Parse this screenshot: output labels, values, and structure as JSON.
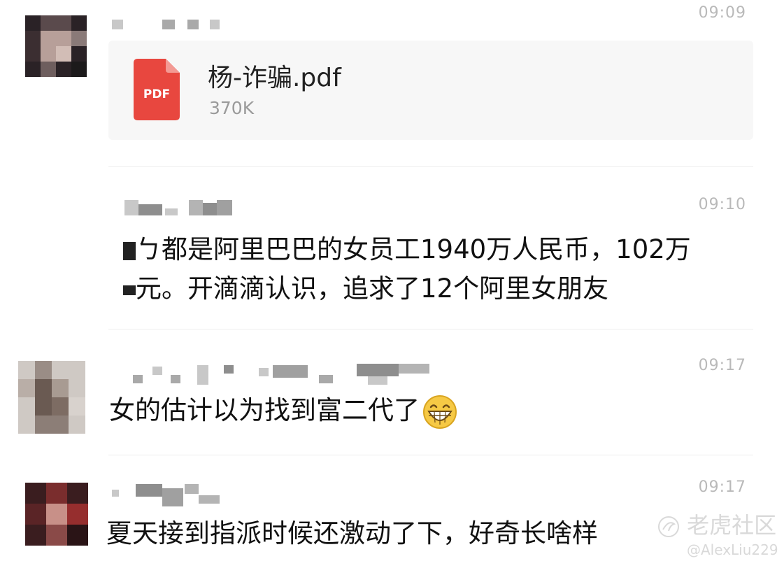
{
  "messages": [
    {
      "time": "09:09",
      "file": {
        "icon": "pdf-icon",
        "icon_label": "PDF",
        "name": "杨-诈骗.pdf",
        "size": "370K",
        "icon_color": "#e8473f"
      }
    },
    {
      "time": "09:10",
      "lines": [
        "ㄅ都是阿里巴巴的女员工1940万人民币，102万",
        "元。开滴滴认识，追求了12个阿里女朋友"
      ]
    },
    {
      "time": "09:17",
      "text": "女的估计以为找到富二代了",
      "emoji": "grinning-face-emoji"
    },
    {
      "time": "09:17",
      "text": "夏天接到指派时候还激动了下，好奇长啥样"
    }
  ],
  "watermark": {
    "brand": "老虎社区",
    "handle": "@AlexLiu229"
  }
}
